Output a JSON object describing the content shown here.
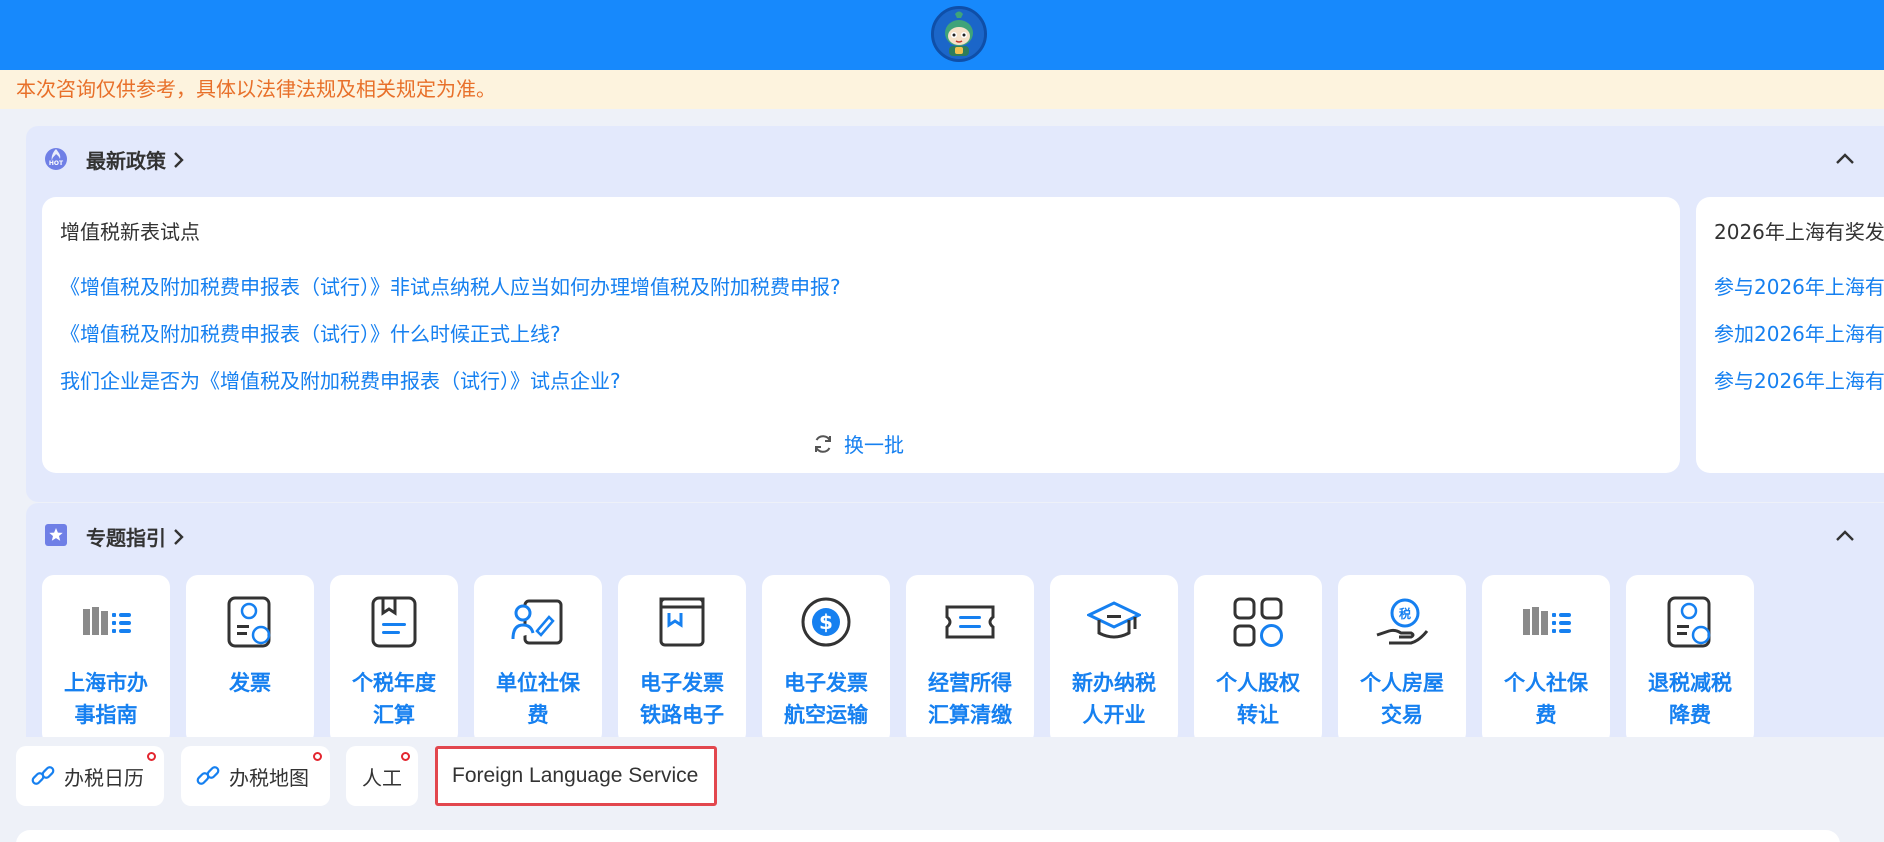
{
  "header": {
    "avatar_icon": "robot-avatar-icon",
    "brand_color": "#1789fc"
  },
  "notice": {
    "text": "本次咨询仅供参考，具体以法律法规及相关规定为准。",
    "color": "#e8702a"
  },
  "policy": {
    "title": "最新政策",
    "icon": "hot-icon",
    "cards": [
      {
        "title": "增值税新表试点",
        "links": [
          "《增值税及附加税费申报表（试行）》非试点纳税人应当如何办理增值税及附加税费申报?",
          "《增值税及附加税费申报表（试行）》什么时候正式上线?",
          "我们企业是否为《增值税及附加税费申报表（试行）》试点企业?"
        ],
        "refresh_label": "换一批"
      },
      {
        "title": "2026年上海有奖发",
        "links": [
          "参与2026年上海有",
          "参加2026年上海有",
          "参与2026年上海有"
        ]
      }
    ]
  },
  "topics": {
    "title": "专题指引",
    "icon": "star-icon",
    "tiles": [
      {
        "line1": "上海市办",
        "line2": "事指南",
        "icon": "tax-list-icon"
      },
      {
        "line1": "发票",
        "line2": "",
        "icon": "invoice-icon"
      },
      {
        "line1": "个税年度",
        "line2": "汇算",
        "icon": "document-icon"
      },
      {
        "line1": "单位社保",
        "line2": "费",
        "icon": "person-edit-icon"
      },
      {
        "line1": "电子发票",
        "line2": "铁路电子",
        "icon": "ticket-box-icon"
      },
      {
        "line1": "电子发票",
        "line2": "航空运输",
        "icon": "dollar-icon"
      },
      {
        "line1": "经营所得",
        "line2": "汇算清缴",
        "icon": "coupon-icon"
      },
      {
        "line1": "新办纳税",
        "line2": "人开业",
        "icon": "graduation-cap-icon"
      },
      {
        "line1": "个人股权",
        "line2": "转让",
        "icon": "grid-apps-icon"
      },
      {
        "line1": "个人房屋",
        "line2": "交易",
        "icon": "hand-tax-icon"
      },
      {
        "line1": "个人社保",
        "line2": "费",
        "icon": "tax-list-icon"
      },
      {
        "line1": "退税减税",
        "line2": "降费",
        "icon": "tax-reduce-icon"
      }
    ]
  },
  "quick_actions": [
    {
      "label": "办税日历",
      "icon": "link-icon",
      "has_dot": true
    },
    {
      "label": "办税地图",
      "icon": "link-icon",
      "has_dot": true
    },
    {
      "label": "人工",
      "has_dot": true
    },
    {
      "label": "Foreign Language Service",
      "highlighted": true
    }
  ],
  "accent_color": "#1680f0"
}
